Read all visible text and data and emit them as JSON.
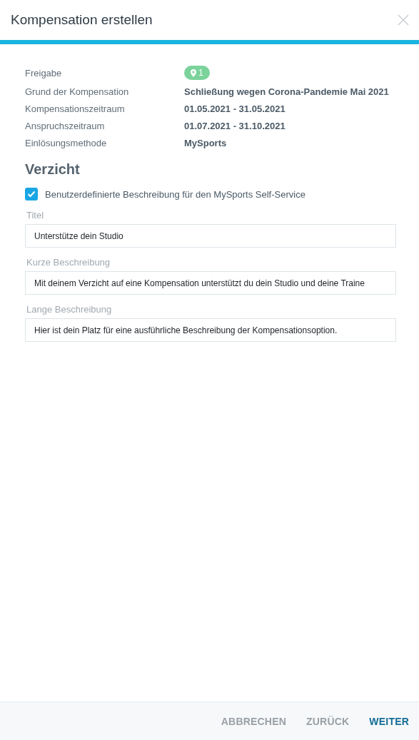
{
  "dialog": {
    "title": "Kompensation erstellen"
  },
  "details": [
    {
      "label": "Freigabe",
      "kind": "badge",
      "value": "1"
    },
    {
      "label": "Grund der Kompensation",
      "kind": "text",
      "value": "Schließung wegen Corona-Pandemie Mai 2021"
    },
    {
      "label": "Kompensationszeitraum",
      "kind": "text",
      "value": "01.05.2021 - 31.05.2021"
    },
    {
      "label": "Anspruchszeitraum",
      "kind": "text",
      "value": "01.07.2021 - 31.10.2021"
    },
    {
      "label": "Einlösungsmethode",
      "kind": "text",
      "value": "MySports"
    }
  ],
  "section": {
    "heading": "Verzicht",
    "checkbox": {
      "label": "Benutzerdefinierte Beschreibung für den MySports Self-Service",
      "checked": true
    },
    "fields": [
      {
        "label": "Titel",
        "value": "Unterstütze dein Studio"
      },
      {
        "label": "Kurze Beschreibung",
        "value": "Mit deinem Verzicht auf eine Kompensation unterstützt du dein Studio und deine Traine"
      },
      {
        "label": "Lange Beschreibung",
        "value": "Hier ist dein Platz für eine ausführliche Beschreibung der Kompensationsoption."
      }
    ]
  },
  "buttons": [
    {
      "label": "ABBRECHEN",
      "kind": "secondary"
    },
    {
      "label": "ZURÜCK",
      "kind": "secondary"
    },
    {
      "label": "WEITER",
      "kind": "primary"
    }
  ]
}
